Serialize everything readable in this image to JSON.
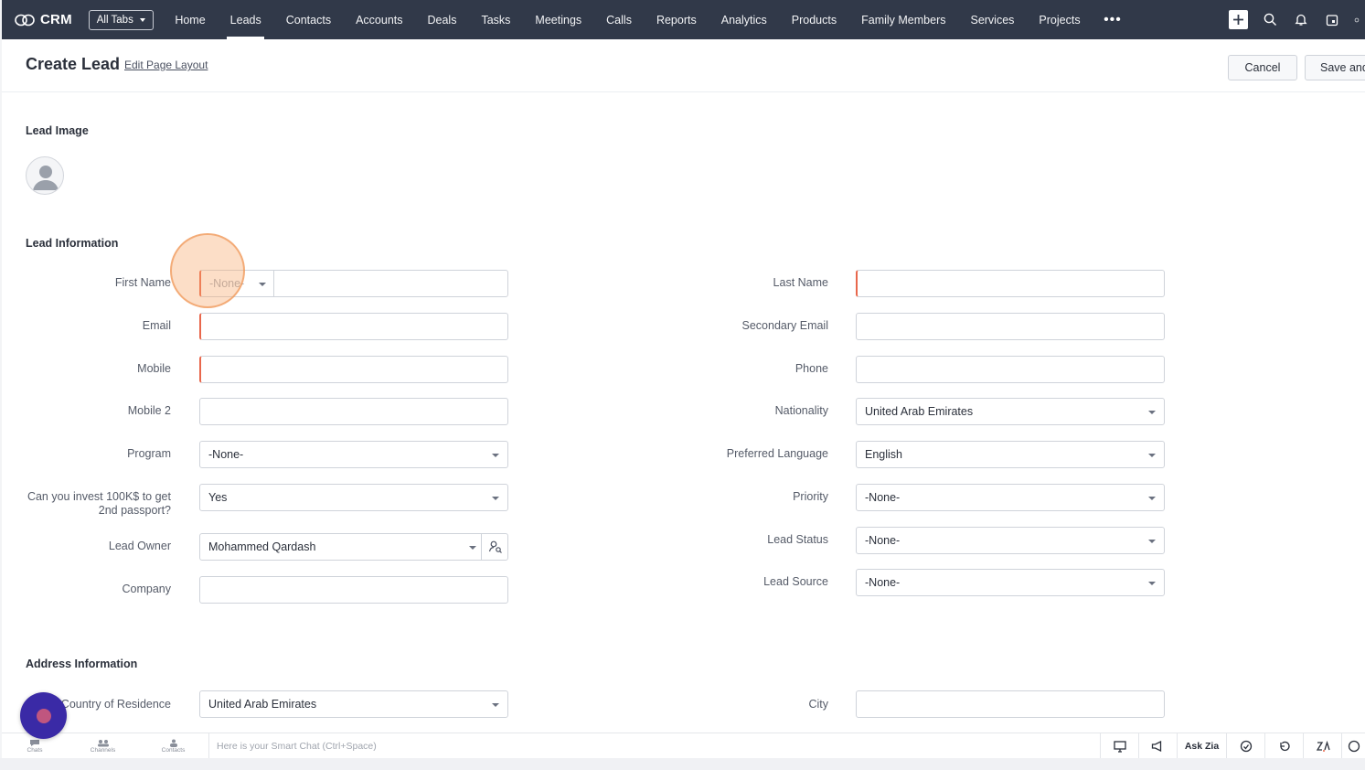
{
  "app": {
    "name": "CRM",
    "all_tabs_label": "All Tabs"
  },
  "nav": {
    "tabs": [
      {
        "label": "Home"
      },
      {
        "label": "Leads"
      },
      {
        "label": "Contacts"
      },
      {
        "label": "Accounts"
      },
      {
        "label": "Deals"
      },
      {
        "label": "Tasks"
      },
      {
        "label": "Meetings"
      },
      {
        "label": "Calls"
      },
      {
        "label": "Reports"
      },
      {
        "label": "Analytics"
      },
      {
        "label": "Products"
      },
      {
        "label": "Family Members"
      },
      {
        "label": "Services"
      },
      {
        "label": "Projects"
      }
    ],
    "active_tab": "Leads",
    "more": "•••"
  },
  "header": {
    "title": "Create Lead",
    "edit_layout": "Edit Page Layout",
    "cancel": "Cancel",
    "save": "Save and"
  },
  "sections": {
    "image": "Lead Image",
    "info": "Lead Information",
    "address": "Address Information"
  },
  "left_fields": {
    "first_name": {
      "label": "First Name",
      "salutation": "-None-"
    },
    "email": {
      "label": "Email",
      "value": ""
    },
    "mobile": {
      "label": "Mobile",
      "value": ""
    },
    "mobile2": {
      "label": "Mobile 2",
      "value": ""
    },
    "program": {
      "label": "Program",
      "value": "-None-"
    },
    "invest": {
      "label_line1": "Can you invest 100K$ to get",
      "label_line2": "2nd passport?",
      "value": "Yes"
    },
    "owner": {
      "label": "Lead Owner",
      "value": "Mohammed Qardash"
    },
    "company": {
      "label": "Company",
      "value": ""
    }
  },
  "right_fields": {
    "last_name": {
      "label": "Last Name",
      "value": ""
    },
    "secondary_email": {
      "label": "Secondary Email",
      "value": ""
    },
    "phone": {
      "label": "Phone",
      "value": ""
    },
    "nationality": {
      "label": "Nationality",
      "value": "United Arab Emirates"
    },
    "preferred_language": {
      "label": "Preferred Language",
      "value": "English"
    },
    "priority": {
      "label": "Priority",
      "value": "-None-"
    },
    "lead_status": {
      "label": "Lead Status",
      "value": "-None-"
    },
    "lead_source": {
      "label": "Lead Source",
      "value": "-None-"
    }
  },
  "address_fields": {
    "country": {
      "label": "Country of Residence",
      "value": "United Arab Emirates"
    },
    "city": {
      "label": "City",
      "value": ""
    }
  },
  "bottom": {
    "chats": "Chats",
    "channels": "Channels",
    "contacts": "Contacts",
    "smart_chat_placeholder": "Here is your Smart Chat (Ctrl+Space)",
    "ask_zia": "Ask Zia"
  },
  "colors": {
    "nav_bg": "#313949",
    "required": "#e8674c",
    "fab": "#3a2aa6"
  }
}
